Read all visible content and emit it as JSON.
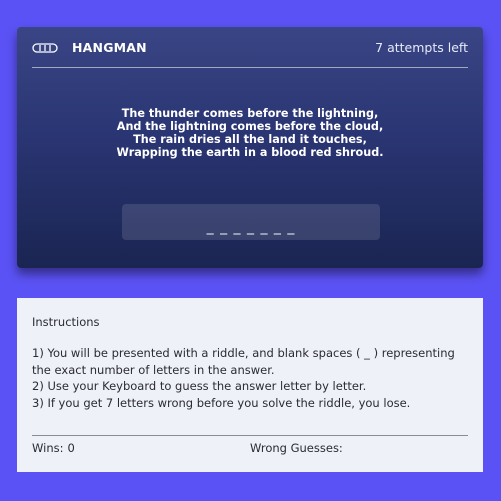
{
  "header": {
    "title": "HANGMAN",
    "attempts": "7 attempts left",
    "logo_icon": "logo-icon"
  },
  "riddle": {
    "lines": [
      "The thunder comes before the lightning,",
      "And the lightning comes before the cloud,",
      "The rain dries all the land it touches,",
      "Wrapping the earth in a blood red shroud."
    ]
  },
  "answer": {
    "blanks": "_ _ _ _ _ _ _"
  },
  "instructions": {
    "title": "Instructions",
    "items": [
      "1) You will be presented with a riddle, and blank spaces ( _ ) representing the exact number of letters in the answer.",
      "2) Use your Keyboard to guess the answer letter by letter.",
      "3) If you get 7 letters wrong before you solve the riddle, you lose."
    ]
  },
  "stats": {
    "wins_label": "Wins:",
    "wins_value": "0",
    "wrong_label": "Wrong Guesses:",
    "wrong_value": ""
  },
  "colors": {
    "page_background": "#5b52f5",
    "card_top": "#3a4585",
    "card_bottom": "#1a2552",
    "info_background": "#eef1f7"
  }
}
